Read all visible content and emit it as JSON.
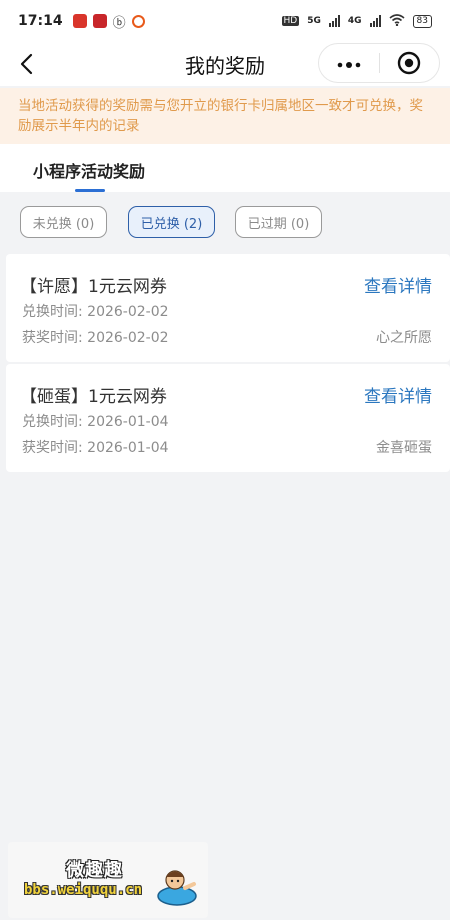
{
  "status_bar": {
    "time": "17:14",
    "network_1": "HD",
    "network_2": "5G",
    "network_3": "4G",
    "battery": "83"
  },
  "nav": {
    "title": "我的奖励"
  },
  "notice": {
    "text": "当地活动获得的奖励需与您开立的银行卡归属地区一致才可兑换，奖励展示半年内的记录"
  },
  "tabs": [
    {
      "label": "小程序活动奖励",
      "active": true
    }
  ],
  "filters": [
    {
      "label": "未兑换 (0)",
      "selected": false
    },
    {
      "label": "已兑换 (2)",
      "selected": true
    },
    {
      "label": "已过期 (0)",
      "selected": false
    }
  ],
  "rewards": [
    {
      "title": "【许愿】1元云网券",
      "link": "查看详情",
      "redeem_time": "兑换时间: 2026-02-02",
      "award_time": "获奖时间: 2026-02-02",
      "activity": "心之所愿"
    },
    {
      "title": "【砸蛋】1元云网券",
      "link": "查看详情",
      "redeem_time": "兑换时间: 2026-01-04",
      "award_time": "获奖时间: 2026-01-04",
      "activity": "金喜砸蛋"
    }
  ],
  "watermark": {
    "name": "微趣趣",
    "url": "bbs.weiququ.cn"
  },
  "colors": {
    "accent": "#2b77bf",
    "notice_bg": "#fdf1e6",
    "notice_text": "#e09a4c",
    "selected_filter": "#2e5fa8"
  }
}
